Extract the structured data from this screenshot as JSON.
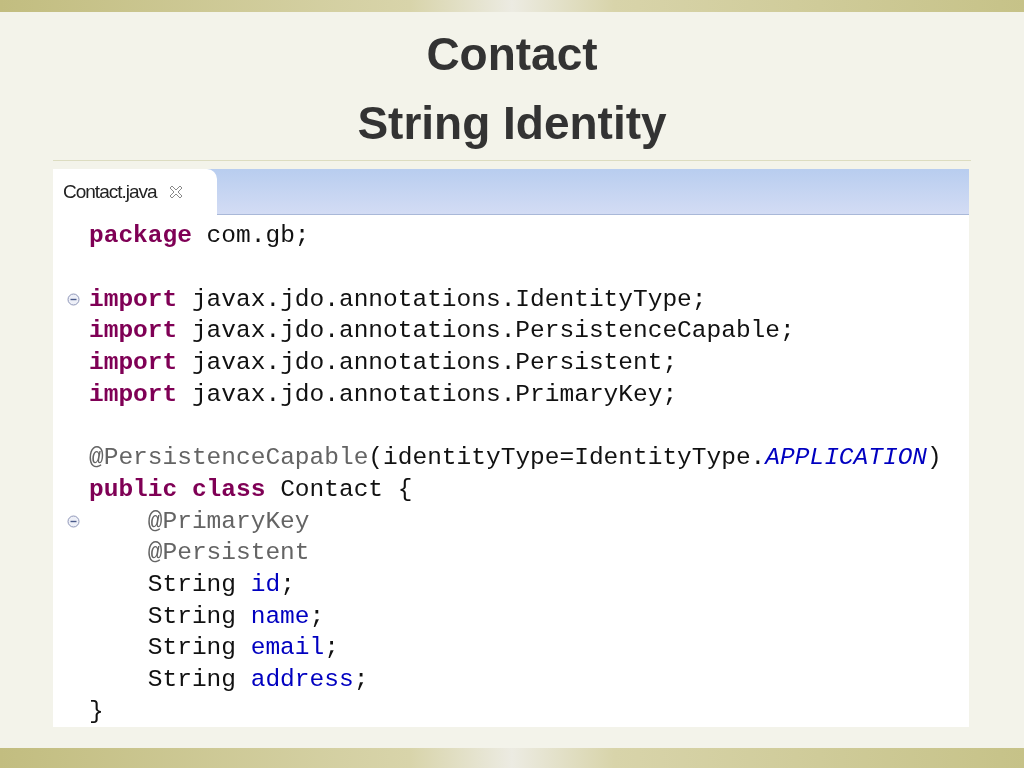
{
  "slide": {
    "title_lines": [
      "Contact",
      "String Identity"
    ]
  },
  "editor": {
    "tabs": [
      {
        "label": "Contact.java",
        "selected": true
      }
    ],
    "lines": [
      {
        "kind": "code",
        "fold": false,
        "tokens": [
          {
            "kind": "keyword",
            "text": "package"
          },
          {
            "kind": "plain",
            "text": " com.gb;"
          }
        ]
      },
      {
        "kind": "blank"
      },
      {
        "kind": "code",
        "fold": true,
        "tokens": [
          {
            "kind": "keyword",
            "text": "import"
          },
          {
            "kind": "plain",
            "text": " javax.jdo.annotations.IdentityType;"
          }
        ]
      },
      {
        "kind": "code",
        "fold": false,
        "tokens": [
          {
            "kind": "keyword",
            "text": "import"
          },
          {
            "kind": "plain",
            "text": " javax.jdo.annotations.PersistenceCapable;"
          }
        ]
      },
      {
        "kind": "code",
        "fold": false,
        "tokens": [
          {
            "kind": "keyword",
            "text": "import"
          },
          {
            "kind": "plain",
            "text": " javax.jdo.annotations.Persistent;"
          }
        ]
      },
      {
        "kind": "code",
        "fold": false,
        "tokens": [
          {
            "kind": "keyword",
            "text": "import"
          },
          {
            "kind": "plain",
            "text": " javax.jdo.annotations.PrimaryKey;"
          }
        ]
      },
      {
        "kind": "blank"
      },
      {
        "kind": "code",
        "fold": false,
        "tokens": [
          {
            "kind": "annotation",
            "text": "@PersistenceCapable"
          },
          {
            "kind": "plain",
            "text": "(identityType=IdentityType."
          },
          {
            "kind": "constant",
            "text": "APPLICATION"
          },
          {
            "kind": "plain",
            "text": ")"
          }
        ]
      },
      {
        "kind": "code",
        "fold": false,
        "tokens": [
          {
            "kind": "keyword",
            "text": "public"
          },
          {
            "kind": "keyword",
            "text": " class"
          },
          {
            "kind": "plain",
            "text": " Contact {"
          }
        ],
        "children": [
          {
            "kind": "code",
            "fold": true,
            "tokens": [
              {
                "kind": "annotation",
                "text": "@PrimaryKey"
              }
            ]
          },
          {
            "kind": "code",
            "fold": false,
            "tokens": [
              {
                "kind": "annotation",
                "text": "@Persistent"
              }
            ]
          },
          {
            "kind": "code",
            "fold": false,
            "tokens": [
              {
                "kind": "plain",
                "text": "String "
              },
              {
                "kind": "field",
                "text": "id"
              },
              {
                "kind": "plain",
                "text": ";"
              }
            ]
          },
          {
            "kind": "code",
            "fold": false,
            "tokens": [
              {
                "kind": "plain",
                "text": "String "
              },
              {
                "kind": "field",
                "text": "name"
              },
              {
                "kind": "plain",
                "text": ";"
              }
            ]
          },
          {
            "kind": "code",
            "fold": false,
            "tokens": [
              {
                "kind": "plain",
                "text": "String "
              },
              {
                "kind": "field",
                "text": "email"
              },
              {
                "kind": "plain",
                "text": ";"
              }
            ]
          },
          {
            "kind": "code",
            "fold": false,
            "tokens": [
              {
                "kind": "plain",
                "text": "String "
              },
              {
                "kind": "field",
                "text": "address"
              },
              {
                "kind": "plain",
                "text": ";"
              }
            ]
          }
        ]
      },
      {
        "kind": "code",
        "fold": false,
        "tokens": [
          {
            "kind": "plain",
            "text": "}"
          }
        ]
      }
    ]
  }
}
